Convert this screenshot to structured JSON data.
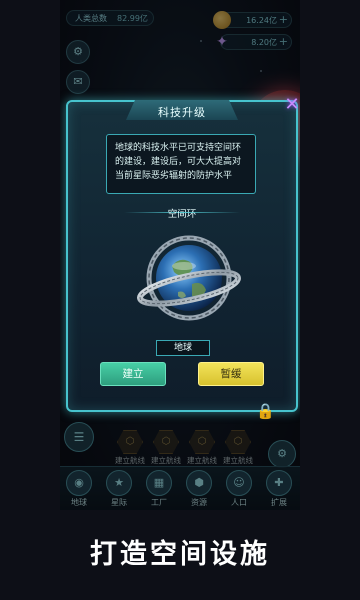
{
  "hud": {
    "population_label": "人类总数",
    "population_value": "82.99亿",
    "coins": "16.24亿",
    "satellites": "8.20亿"
  },
  "modal": {
    "title": "科技升级",
    "description": "地球的科技水平已可支持空间环的建设，建设后，可大大提高对当前星际恶劣辐射的防护水平",
    "section_label": "空间环",
    "planet_name": "地球",
    "build_label": "建立",
    "pause_label": "暂缓"
  },
  "slots": [
    {
      "label": "建立航线"
    },
    {
      "label": "建立航线"
    },
    {
      "label": "建立航线"
    },
    {
      "label": "建立航线"
    }
  ],
  "bottom_nav": [
    {
      "label": "地球",
      "icon": "earth-icon"
    },
    {
      "label": "星际",
      "icon": "star-icon"
    },
    {
      "label": "工厂",
      "icon": "factory-icon"
    },
    {
      "label": "资源",
      "icon": "resource-icon"
    },
    {
      "label": "人口",
      "icon": "population-icon"
    },
    {
      "label": "扩展",
      "icon": "expand-icon"
    }
  ],
  "caption": "打造空间设施",
  "colors": {
    "accent": "#47c3cd",
    "build_button": "#3fbf98",
    "pause_button": "#e9d844"
  }
}
